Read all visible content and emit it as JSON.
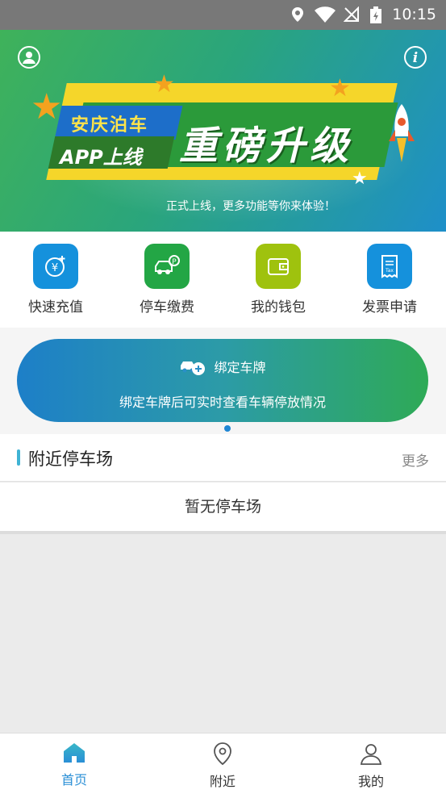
{
  "status_bar": {
    "time": "10:15"
  },
  "banner": {
    "tag_line1": "安庆泊车",
    "tag_line2": "APP上线",
    "headline": "重磅升级",
    "subtitle": "正式上线，更多功能等你来体验！"
  },
  "quick_actions": [
    {
      "label": "快速充值",
      "icon": "yuan-recharge-icon",
      "color": "#1591dc"
    },
    {
      "label": "停车缴费",
      "icon": "car-parking-icon",
      "color": "#23a645"
    },
    {
      "label": "我的钱包",
      "icon": "wallet-icon",
      "color": "#9fc20e"
    },
    {
      "label": "发票申请",
      "icon": "invoice-icon",
      "color": "#1591dc"
    }
  ],
  "bind_card": {
    "title": "绑定车牌",
    "subtitle": "绑定车牌后可实时查看车辆停放情况"
  },
  "nearby": {
    "title": "附近停车场",
    "more": "更多",
    "empty_text": "暂无停车场"
  },
  "tabs": [
    {
      "label": "首页",
      "icon": "home-icon",
      "active": true
    },
    {
      "label": "附近",
      "icon": "location-pin-icon",
      "active": false
    },
    {
      "label": "我的",
      "icon": "person-icon",
      "active": false
    }
  ],
  "colors": {
    "accent": "#2a8fd6",
    "green": "#2eaa56"
  }
}
